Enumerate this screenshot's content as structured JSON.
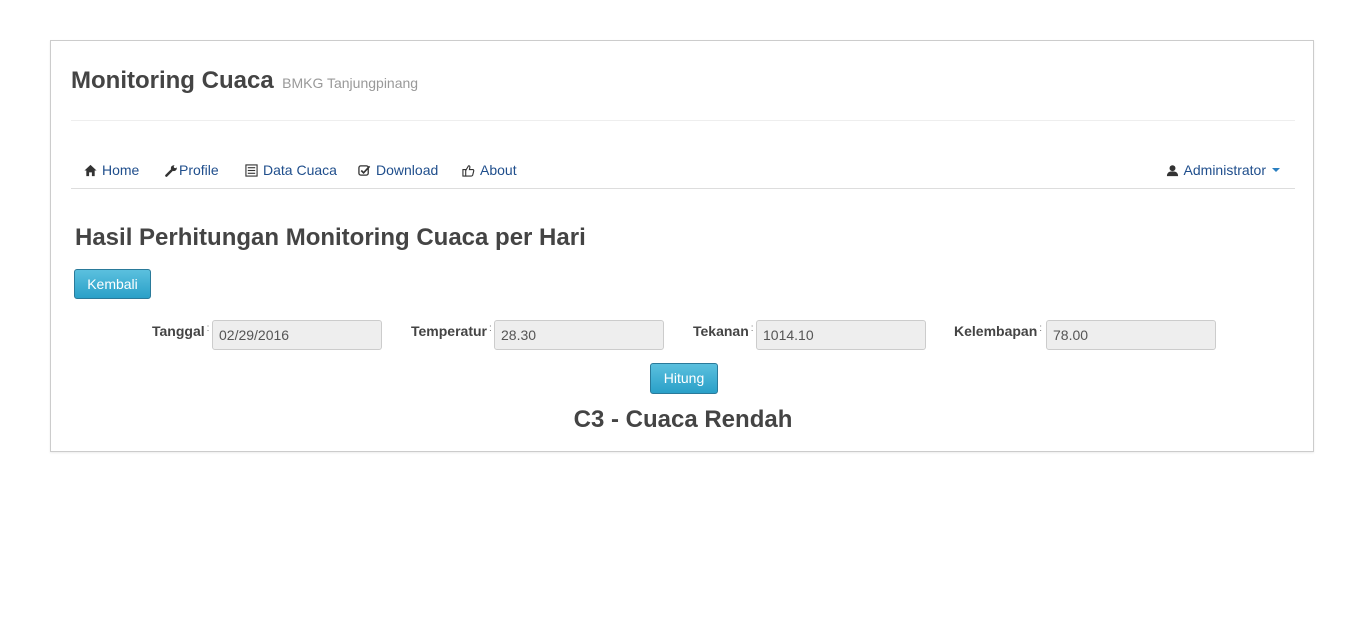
{
  "header": {
    "title": "Monitoring Cuaca",
    "subtitle": "BMKG Tanjungpinang"
  },
  "nav": {
    "home": "Home",
    "profile": "Profile",
    "data_cuaca": "Data Cuaca",
    "download": "Download",
    "about": "About",
    "user": "Administrator"
  },
  "main": {
    "heading": "Hasil Perhitungan Monitoring Cuaca per Hari",
    "back_label": "Kembali",
    "calculate_label": "Hitung",
    "result": "C3 - Cuaca Rendah"
  },
  "form": {
    "tanggal": {
      "label": "Tanggal",
      "value": "02/29/2016"
    },
    "temperatur": {
      "label": "Temperatur",
      "value": "28.30"
    },
    "tekanan": {
      "label": "Tekanan",
      "value": "1014.10"
    },
    "kelembapan": {
      "label": "Kelembapan",
      "value": "78.00"
    },
    "separator": ":"
  },
  "colors": {
    "button_primary": "#31b0d5",
    "nav_link": "#1f4e8c",
    "caret": "#2a7fc0"
  },
  "icons": {
    "home": "home-icon",
    "profile": "wrench-icon",
    "data_cuaca": "list-icon",
    "download": "check-icon",
    "about": "thumbs-up-icon",
    "user": "user-icon"
  }
}
